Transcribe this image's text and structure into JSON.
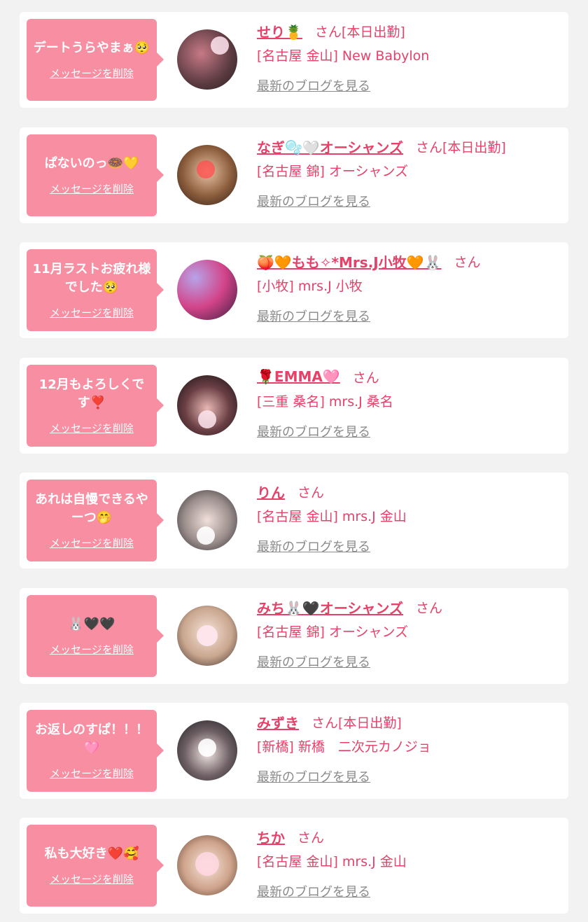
{
  "delete_label": "メッセージを削除",
  "blog_label": "最新のブログを見る",
  "colors": {
    "background": "#f2f2f2",
    "card": "#ffffff",
    "bubble": "#f78ea2",
    "accent": "#e5426a",
    "link_gray": "#8a8a8a"
  },
  "items": [
    {
      "message": "デートうらやまぁ🥺",
      "name": "せり🍍",
      "suffix": "さん[本日出勤]",
      "shop": "[名古屋 金山] New Babylon",
      "avatar_bg": "radial-gradient(circle at 40% 40%, #c77a86, #5a3a40 60%, #2a2023)"
    },
    {
      "message": "ぱないのっ🍩💛",
      "name": "なぎ🫧🤍オーシャンズ",
      "suffix": "さん[本日出勤]",
      "shop": "[名古屋 錦] オーシャンズ",
      "avatar_bg": "radial-gradient(circle at 50% 45%, #e8c3a5, #8a5c3c 55%, #2c1d14)"
    },
    {
      "message": "11月ラストお疲れ様でした🥺",
      "name": "🍑🧡もも✧*Mrs.J小牧🧡🐰",
      "suffix": "さん",
      "shop": "[小牧] mrs.J 小牧",
      "avatar_bg": "radial-gradient(circle at 30% 30%, #b7a3e8, #d3448a 50%, #3a1e3d)"
    },
    {
      "message": "12月もよろしくです❣️",
      "name": "🌹EMMA🩷",
      "suffix": "さん",
      "shop": "[三重 桑名] mrs.J 桑名",
      "avatar_bg": "radial-gradient(circle at 50% 55%, #e8b8b4, #6a3f44 50%, #120f12)"
    },
    {
      "message": "あれは自慢できるやーつ🤭",
      "name": "りん",
      "suffix": "さん",
      "shop": "[名古屋 金山] mrs.J 金山",
      "avatar_bg": "radial-gradient(circle at 50% 50%, #f1e0da, #9a8d8b 55%, #2a2a2c)"
    },
    {
      "message": "🐰🖤🖤",
      "name": "みち🐰🖤オーシャンズ",
      "suffix": "さん",
      "shop": "[名古屋 錦] オーシャンズ",
      "avatar_bg": "radial-gradient(circle at 50% 45%, #f6e3d8, #c9a68f 55%, #3a2b24)"
    },
    {
      "message": "お返しのすぱ！！！🩷",
      "name": "みずき",
      "suffix": "さん[本日出勤]",
      "shop": "[新橋] 新橋　二次元カノジョ",
      "avatar_bg": "radial-gradient(circle at 50% 55%, #f3e6e4, #6f6165 50%, #1b1a1f)"
    },
    {
      "message": "私も大好き❤️🥰",
      "name": "ちか",
      "suffix": "さん",
      "shop": "[名古屋 金山] mrs.J 金山",
      "avatar_bg": "radial-gradient(circle at 50% 50%, #f7e6dc, #cfa48c 55%, #5a3e2e)"
    }
  ]
}
